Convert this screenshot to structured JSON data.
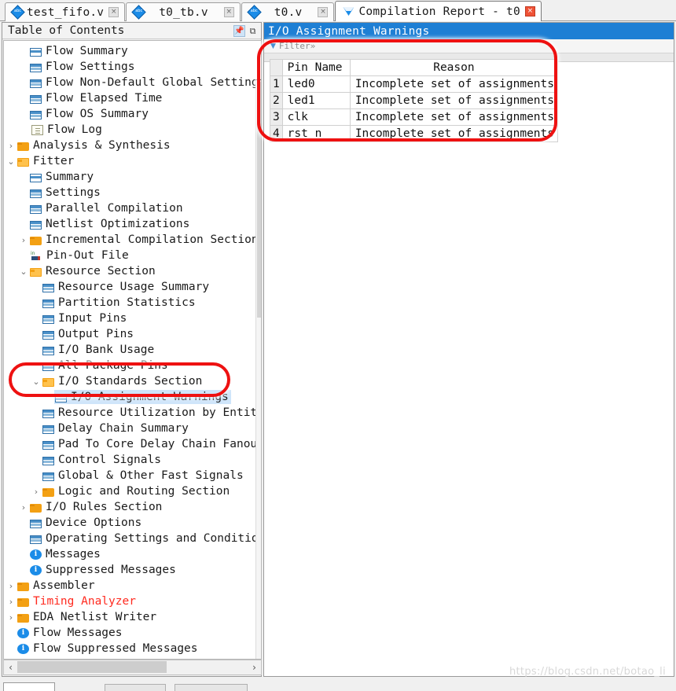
{
  "tabs": [
    {
      "label": "test_fifo.v",
      "icon": "verilog-file-icon",
      "active": false,
      "close": "×"
    },
    {
      "label": "t0_tb.v",
      "icon": "verilog-file-icon",
      "active": false,
      "close": "×"
    },
    {
      "label": "t0.v",
      "icon": "verilog-file-icon",
      "active": false,
      "close": "×"
    },
    {
      "label": "Compilation Report - t0",
      "icon": "compilation-report-icon",
      "active": true,
      "close": "×"
    }
  ],
  "toc": {
    "title": "Table of Contents",
    "pin_icon": "pin-icon",
    "float_icon": "float-window-icon",
    "items": [
      {
        "label": "Flow Summary",
        "indent": 1,
        "twisty": "",
        "icon": "table-icon"
      },
      {
        "label": "Flow Settings",
        "indent": 1,
        "twisty": "",
        "icon": "table2-icon"
      },
      {
        "label": "Flow Non-Default Global Settings",
        "indent": 1,
        "twisty": "",
        "icon": "table2-icon"
      },
      {
        "label": "Flow Elapsed Time",
        "indent": 1,
        "twisty": "",
        "icon": "table2-icon"
      },
      {
        "label": "Flow OS Summary",
        "indent": 1,
        "twisty": "",
        "icon": "table2-icon"
      },
      {
        "label": "Flow Log",
        "indent": 1,
        "twisty": "",
        "icon": "document-icon"
      },
      {
        "label": "Analysis & Synthesis",
        "indent": 0,
        "twisty": "›",
        "icon": "folder-icon"
      },
      {
        "label": "Fitter",
        "indent": 0,
        "twisty": "⌄",
        "icon": "folder-open-icon"
      },
      {
        "label": "Summary",
        "indent": 1,
        "twisty": "",
        "icon": "table-icon"
      },
      {
        "label": "Settings",
        "indent": 1,
        "twisty": "",
        "icon": "table2-icon"
      },
      {
        "label": "Parallel Compilation",
        "indent": 1,
        "twisty": "",
        "icon": "table2-icon"
      },
      {
        "label": "Netlist Optimizations",
        "indent": 1,
        "twisty": "",
        "icon": "table2-icon"
      },
      {
        "label": "Incremental Compilation Section",
        "indent": 1,
        "twisty": "›",
        "icon": "folder-icon"
      },
      {
        "label": "Pin-Out File",
        "indent": 1,
        "twisty": "",
        "icon": "pinout-icon"
      },
      {
        "label": "Resource Section",
        "indent": 1,
        "twisty": "⌄",
        "icon": "folder-open-icon"
      },
      {
        "label": "Resource Usage Summary",
        "indent": 2,
        "twisty": "",
        "icon": "table2-icon"
      },
      {
        "label": "Partition Statistics",
        "indent": 2,
        "twisty": "",
        "icon": "table2-icon"
      },
      {
        "label": "Input Pins",
        "indent": 2,
        "twisty": "",
        "icon": "table2-icon"
      },
      {
        "label": "Output Pins",
        "indent": 2,
        "twisty": "",
        "icon": "table2-icon"
      },
      {
        "label": "I/O Bank Usage",
        "indent": 2,
        "twisty": "",
        "icon": "table2-icon"
      },
      {
        "label": "All Package Pins",
        "indent": 2,
        "twisty": "",
        "icon": "table2-icon"
      },
      {
        "label": "I/O Standards Section",
        "indent": 2,
        "twisty": "⌄",
        "icon": "folder-open-icon"
      },
      {
        "label": "I/O Assignment Warnings",
        "indent": 3,
        "twisty": "",
        "icon": "table2-icon",
        "selected": true
      },
      {
        "label": "Resource Utilization by Entity",
        "indent": 2,
        "twisty": "",
        "icon": "table2-icon"
      },
      {
        "label": "Delay Chain Summary",
        "indent": 2,
        "twisty": "",
        "icon": "table2-icon"
      },
      {
        "label": "Pad To Core Delay Chain Fanout",
        "indent": 2,
        "twisty": "",
        "icon": "table2-icon"
      },
      {
        "label": "Control Signals",
        "indent": 2,
        "twisty": "",
        "icon": "table2-icon"
      },
      {
        "label": "Global & Other Fast Signals",
        "indent": 2,
        "twisty": "",
        "icon": "table2-icon"
      },
      {
        "label": "Logic and Routing Section",
        "indent": 2,
        "twisty": "›",
        "icon": "folder-icon"
      },
      {
        "label": "I/O Rules Section",
        "indent": 1,
        "twisty": "›",
        "icon": "folder-icon"
      },
      {
        "label": "Device Options",
        "indent": 1,
        "twisty": "",
        "icon": "table2-icon"
      },
      {
        "label": "Operating Settings and Conditions",
        "indent": 1,
        "twisty": "",
        "icon": "table2-icon"
      },
      {
        "label": "Messages",
        "indent": 1,
        "twisty": "",
        "icon": "info-icon"
      },
      {
        "label": "Suppressed Messages",
        "indent": 1,
        "twisty": "",
        "icon": "info-icon"
      },
      {
        "label": "Assembler",
        "indent": 0,
        "twisty": "›",
        "icon": "folder-icon"
      },
      {
        "label": "Timing Analyzer",
        "indent": 0,
        "twisty": "›",
        "icon": "folder-icon",
        "red": true
      },
      {
        "label": "EDA Netlist Writer",
        "indent": 0,
        "twisty": "›",
        "icon": "folder-icon"
      },
      {
        "label": "Flow Messages",
        "indent": 0,
        "twisty": "",
        "icon": "info-icon"
      },
      {
        "label": "Flow Suppressed Messages",
        "indent": 0,
        "twisty": "",
        "icon": "info-icon"
      }
    ],
    "hscroll": {
      "left_arrow": "‹",
      "right_arrow": "›"
    }
  },
  "report": {
    "title": "I/O Assignment Warnings",
    "filter_label": "Filter»",
    "filter_twisty": "▼",
    "table": {
      "columns": [
        "",
        "Pin Name",
        "Reason"
      ],
      "rows": [
        {
          "idx": "1",
          "pin": "led0",
          "reason": "Incomplete set of assignments"
        },
        {
          "idx": "2",
          "pin": "led1",
          "reason": "Incomplete set of assignments"
        },
        {
          "idx": "3",
          "pin": "clk",
          "reason": "Incomplete set of assignments"
        },
        {
          "idx": "4",
          "pin": "rst_n",
          "reason": "Incomplete set of assignments"
        }
      ]
    }
  },
  "annotations": {
    "color": "#ee1111"
  },
  "watermark": "https://blog.csdn.net/botao_li"
}
